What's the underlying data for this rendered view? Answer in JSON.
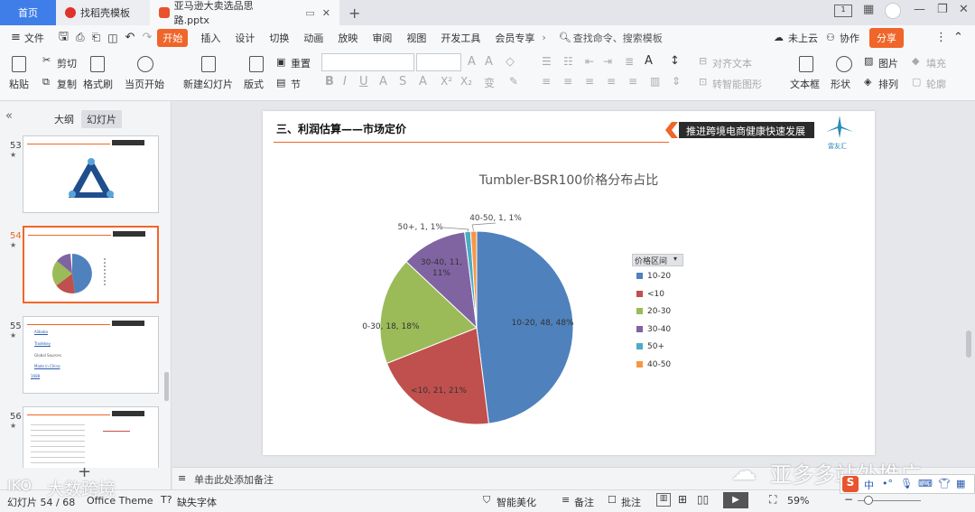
{
  "tabs": {
    "home": "首页",
    "template": "找稻壳模板",
    "doc": "亚马逊大卖选品思路.pptx"
  },
  "menu": {
    "file": "文件",
    "items": [
      "开始",
      "插入",
      "设计",
      "切换",
      "动画",
      "放映",
      "审阅",
      "视图",
      "开发工具",
      "会员专享"
    ],
    "search": "查找命令、搜索模板",
    "cloud": "未上云",
    "collab": "协作",
    "share": "分享"
  },
  "ribbon": {
    "paste": "粘贴",
    "cut": "剪切",
    "copy": "复制",
    "format_painter": "格式刷",
    "play_from": "当页开始",
    "new_slide": "新建幻灯片",
    "layout": "版式",
    "reset": "重置",
    "section": "节",
    "align_text": "对齐文本",
    "smart_shape": "转智能图形",
    "textbox": "文本框",
    "shape": "形状",
    "picture": "图片",
    "arrange": "排列",
    "fill": "填充",
    "outline": "轮廓"
  },
  "panel": {
    "outline_tab": "大纲",
    "slides_tab": "幻灯片",
    "slide_numbers": [
      "53",
      "54",
      "55",
      "56"
    ],
    "slide55_links": [
      "Alibaba",
      "Tradekey",
      "Global Sources",
      "Made in China",
      "1688"
    ]
  },
  "slide": {
    "section_title": "三、利润估算——市场定价",
    "banner": "推进跨境电商健康快速发展",
    "logo_text": "雷友汇",
    "chart_title": "Tumbler-BSR100价格分布占比",
    "legend_header": "价格区间"
  },
  "chart_data": {
    "type": "pie",
    "title": "Tumbler-BSR100价格分布占比",
    "legend_title": "价格区间",
    "legend_position": "right",
    "slices": [
      {
        "label": "10-20",
        "value": 48,
        "percent": 48,
        "color": "#4f81bd",
        "data_label": "10-20, 48, 48%"
      },
      {
        "label": "<10",
        "value": 21,
        "percent": 21,
        "color": "#c0504d",
        "data_label": "<10, 21, 21%"
      },
      {
        "label": "20-30",
        "value": 18,
        "percent": 18,
        "color": "#9bbb59",
        "data_label": "20-30, 18, 18%"
      },
      {
        "label": "30-40",
        "value": 11,
        "percent": 11,
        "color": "#8064a2",
        "data_label": "30-40, 11, 11%"
      },
      {
        "label": "50+",
        "value": 1,
        "percent": 1,
        "color": "#4bacc6",
        "data_label": "50+, 1, 1%"
      },
      {
        "label": "40-50",
        "value": 1,
        "percent": 1,
        "color": "#f79646",
        "data_label": "40-50, 1, 1%"
      }
    ]
  },
  "notes": {
    "placeholder": "单击此处添加备注"
  },
  "status": {
    "slide_counter": "幻灯片 54 / 68",
    "theme": "Office Theme",
    "missing_font": "缺失字体",
    "beautify": "智能美化",
    "notes": "备注",
    "comments": "批注",
    "zoom": "59%"
  },
  "watermark": {
    "left": "大数跨境",
    "right": "亚多多站外推广"
  }
}
